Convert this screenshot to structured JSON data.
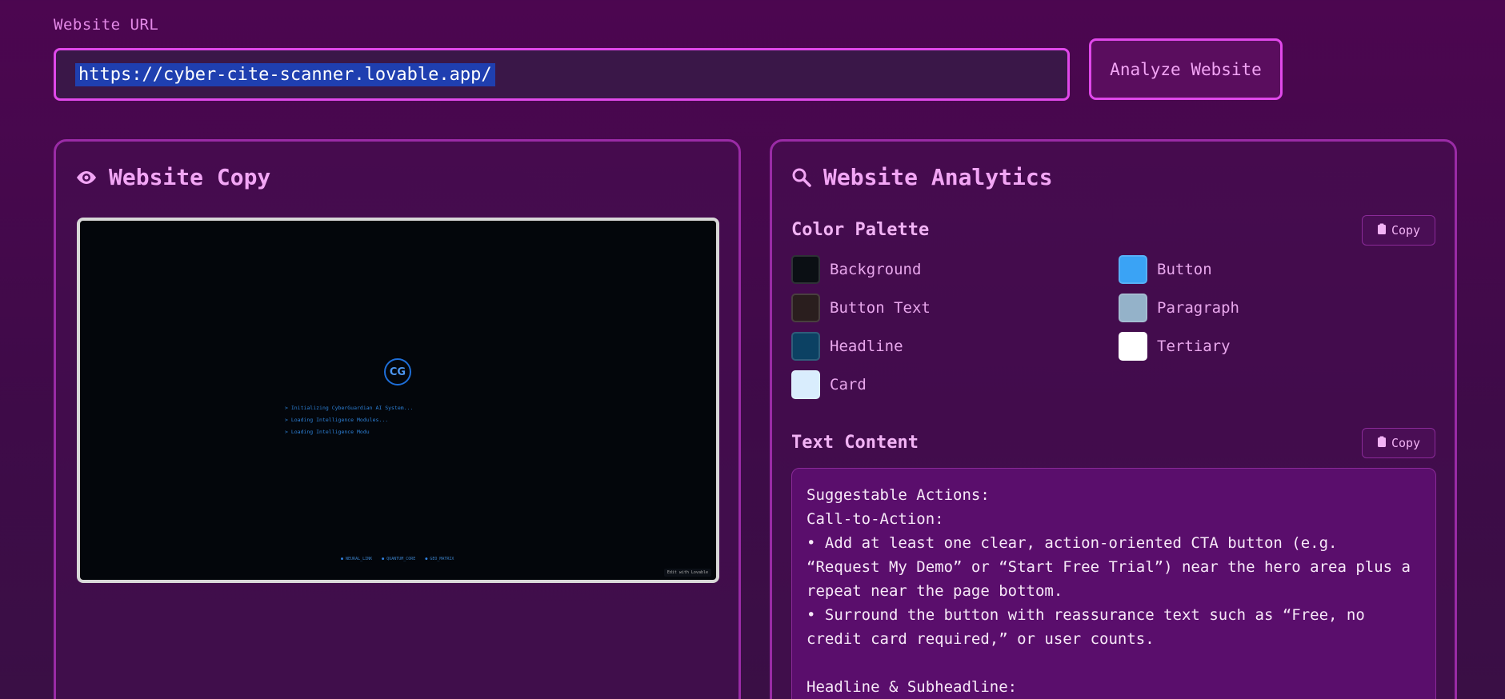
{
  "url_section": {
    "label": "Website URL",
    "value": "https://cyber-cite-scanner.lovable.app/",
    "analyze_label": "Analyze Website"
  },
  "copy_panel": {
    "title": "Website Copy",
    "icon": "eye-icon",
    "preview": {
      "logo_text": "CG",
      "boot_lines": [
        "> Initializing CyberGuardian AI System...",
        "> Loading Intelligence Modules...",
        "> Loading Intelligence Modu"
      ],
      "footer_tags": [
        "NEURAL_LINK",
        "QUANTUM_CORE",
        "GEO_MATRIX"
      ],
      "badge": "Edit with Lovable"
    }
  },
  "analytics_panel": {
    "title": "Website Analytics",
    "icon": "search-icon",
    "color_palette": {
      "title": "Color Palette",
      "copy_label": "Copy",
      "colors": [
        {
          "name": "Background",
          "hex": "#0b0f14"
        },
        {
          "name": "Button",
          "hex": "#3aa3f5"
        },
        {
          "name": "Button Text",
          "hex": "#2a1e1e"
        },
        {
          "name": "Paragraph",
          "hex": "#94b2c9"
        },
        {
          "name": "Headline",
          "hex": "#0c4163"
        },
        {
          "name": "Tertiary",
          "hex": "#ffffff"
        },
        {
          "name": "Card",
          "hex": "#d9edfd"
        }
      ]
    },
    "text_content": {
      "title": "Text Content",
      "copy_label": "Copy",
      "body": "Suggestable Actions:\nCall-to-Action:\n• Add at least one clear, action-oriented CTA button (e.g.\n“Request My Demo” or “Start Free Trial”) near the hero area plus a\nrepeat near the page bottom.\n• Surround the button with reassurance text such as “Free, no\ncredit card required,” or user counts.\n\nHeadline & Subheadline:"
    }
  }
}
